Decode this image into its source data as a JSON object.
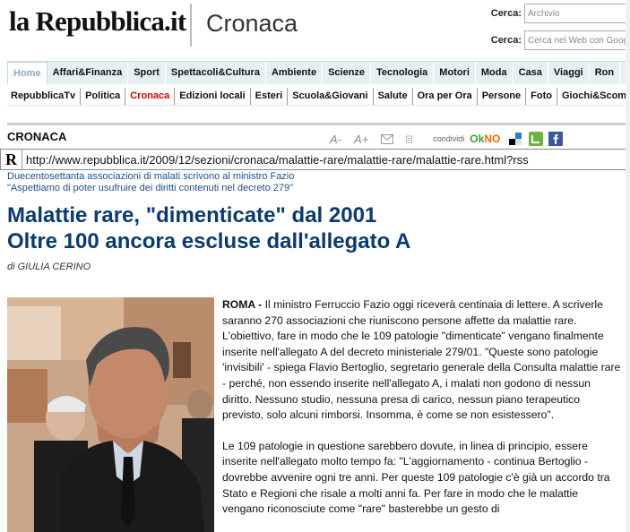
{
  "header": {
    "logo": "la Repubblica.it",
    "section": "Cronaca",
    "search1_label": "Cerca:",
    "search1_placeholder": "Archivio",
    "search2_label": "Cerca:",
    "search2_placeholder": "Cerca nel Web con Goog"
  },
  "nav_primary": [
    "Home",
    "Affari&Finanza",
    "Sport",
    "Spettacoli&Cultura",
    "Ambiente",
    "Scienze",
    "Tecnologia",
    "Motori",
    "Moda",
    "Casa",
    "Viaggi",
    "Ron"
  ],
  "nav_secondary": [
    "RepubblicaTv",
    "Politica",
    "Cronaca",
    "Edizioni locali",
    "Esteri",
    "Scuola&Giovani",
    "Salute",
    "Ora per Ora",
    "Persone",
    "Foto",
    "Giochi&Scomm"
  ],
  "section_bar": {
    "title": "CRONACA",
    "font_smaller": "A-",
    "font_larger": "A+",
    "share_label": "condividi",
    "okno_ok": "Ok",
    "okno_no": "NO"
  },
  "url_bar": {
    "icon": "R",
    "url": "http://www.repubblica.it/2009/12/sezioni/cronaca/malattie-rare/malattie-rare/malattie-rare.html?rss"
  },
  "article": {
    "kicker_line1": "Duecentosettanta associazioni di malati scrivono al ministro Fazio",
    "kicker_line2": "\"Aspettiamo di poter usufruire dei diritti contenuti nel decreto 279\"",
    "headline_line1": "Malattie rare, \"dimenticate\" dal 2001",
    "headline_line2": "Oltre 100 ancora escluse dall'allegato A",
    "byline_prefix": "di",
    "byline_author": "GIULIA CERINO",
    "city": "ROMA -",
    "paragraph1": "Il ministro Ferruccio Fazio oggi riceverà centinaia di lettere. A scriverle saranno 270 associazioni che riuniscono persone affette da malattie rare. L'obiettivo, fare in modo che le 109 patologie \"dimenticate\" vengano finalmente inserite nell'allegato A del decreto ministeriale 279/01. \"Queste sono patologie 'invisibili' - spiega Flavio Bertoglio, segretario generale della Consulta malattie rare - perché, non essendo inserite nell'allegato A, i malati non godono di nessun diritto. Nessuno studio, nessuna presa di carico, nessun piano terapeutico previsto, solo alcuni rimborsi. Insomma, è come se non esistessero\".",
    "paragraph2": "Le 109 patologie in questione sarebbero dovute, in linea di principio, essere inserite nell'allegato molto tempo fa: \"L'aggiornamento - continua Bertoglio - dovrebbe avvenire ogni tre anni. Per queste 109 patologie c'è già un accordo tra Stato e Regioni che risale a molti anni fa. Per fare in modo che le malattie vengano riconosciute come \"rare\" basterebbe un gesto di"
  }
}
